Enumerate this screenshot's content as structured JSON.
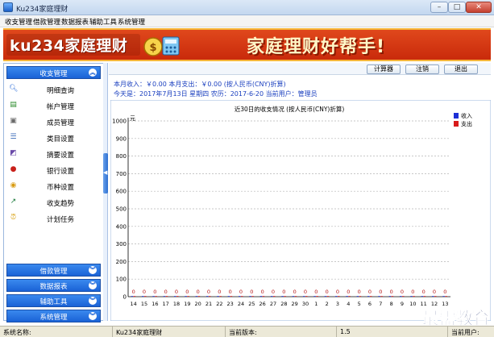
{
  "window": {
    "title": "Ku234家庭理财"
  },
  "menu": [
    "收支管理",
    "借款管理",
    "数据报表",
    "辅助工具",
    "系统管理"
  ],
  "banner": {
    "logo": "ku234家庭理财",
    "slogan": "家庭理财好帮手!"
  },
  "sidebar": {
    "open_group": "收支管理",
    "items": [
      {
        "label": "明细查询",
        "icon": "search-icon"
      },
      {
        "label": "帐户管理",
        "icon": "account-icon"
      },
      {
        "label": "成员管理",
        "icon": "member-icon"
      },
      {
        "label": "类目设置",
        "icon": "category-icon"
      },
      {
        "label": "摘要设置",
        "icon": "summary-icon"
      },
      {
        "label": "银行设置",
        "icon": "bank-icon"
      },
      {
        "label": "币种设置",
        "icon": "currency-icon"
      },
      {
        "label": "收支趋势",
        "icon": "trend-icon"
      },
      {
        "label": "计划任务",
        "icon": "clock-icon"
      }
    ],
    "collapsed_groups": [
      "借款管理",
      "数据报表",
      "辅助工具",
      "系统管理"
    ]
  },
  "toolbar": {
    "calculator": "计算器",
    "logout": "注销",
    "exit": "退出"
  },
  "summary": {
    "line1": "本月收入：￥0.00   本月支出：￥0.00  (按人民币(CNY)折算)",
    "line2": "今天是：2017年7月13日  星期四  农历：2017-6-20  当前用户：管理员"
  },
  "chart_data": {
    "type": "bar",
    "title": "近30日的收支情况 (按人民币(CNY)折算)",
    "ylabel": "元",
    "ylim": [
      0,
      1000
    ],
    "yticks": [
      0,
      100,
      200,
      300,
      400,
      500,
      600,
      700,
      800,
      900,
      1000
    ],
    "grid": true,
    "legend_position": "top-right",
    "categories": [
      "14",
      "15",
      "16",
      "17",
      "18",
      "19",
      "20",
      "21",
      "22",
      "23",
      "24",
      "25",
      "26",
      "27",
      "28",
      "29",
      "30",
      "1",
      "2",
      "3",
      "4",
      "5",
      "6",
      "7",
      "8",
      "9",
      "10",
      "11",
      "12",
      "13"
    ],
    "series": [
      {
        "name": "收入",
        "color": "#1c2fd6",
        "values": [
          0,
          0,
          0,
          0,
          0,
          0,
          0,
          0,
          0,
          0,
          0,
          0,
          0,
          0,
          0,
          0,
          0,
          0,
          0,
          0,
          0,
          0,
          0,
          0,
          0,
          0,
          0,
          0,
          0,
          0
        ]
      },
      {
        "name": "支出",
        "color": "#d81b1b",
        "values": [
          0,
          0,
          0,
          0,
          0,
          0,
          0,
          0,
          0,
          0,
          0,
          0,
          0,
          0,
          0,
          0,
          0,
          0,
          0,
          0,
          0,
          0,
          0,
          0,
          0,
          0,
          0,
          0,
          0,
          0
        ]
      }
    ]
  },
  "statusbar": {
    "system_name_label": "系统名称:",
    "system_name": "Ku234家庭理财",
    "version_label": "当前版本:",
    "version": "1.5",
    "user_label": "当前用户:"
  },
  "watermark": "最需教育"
}
